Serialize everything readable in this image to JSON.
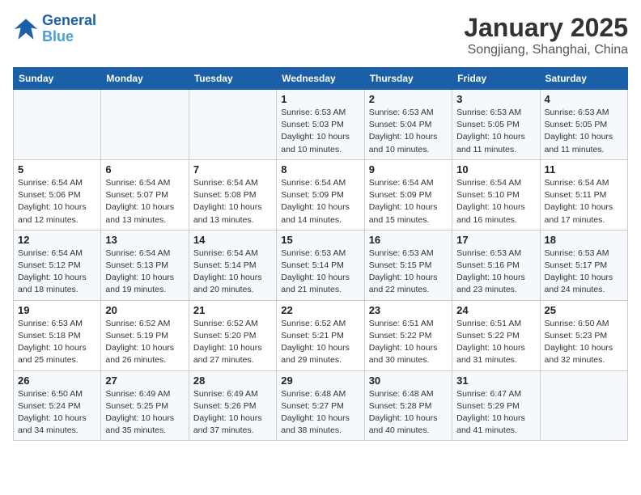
{
  "logo": {
    "line1": "General",
    "line2": "Blue"
  },
  "title": "January 2025",
  "location": "Songjiang, Shanghai, China",
  "weekdays": [
    "Sunday",
    "Monday",
    "Tuesday",
    "Wednesday",
    "Thursday",
    "Friday",
    "Saturday"
  ],
  "weeks": [
    [
      {
        "day": "",
        "info": ""
      },
      {
        "day": "",
        "info": ""
      },
      {
        "day": "",
        "info": ""
      },
      {
        "day": "1",
        "info": "Sunrise: 6:53 AM\nSunset: 5:03 PM\nDaylight: 10 hours\nand 10 minutes."
      },
      {
        "day": "2",
        "info": "Sunrise: 6:53 AM\nSunset: 5:04 PM\nDaylight: 10 hours\nand 10 minutes."
      },
      {
        "day": "3",
        "info": "Sunrise: 6:53 AM\nSunset: 5:05 PM\nDaylight: 10 hours\nand 11 minutes."
      },
      {
        "day": "4",
        "info": "Sunrise: 6:53 AM\nSunset: 5:05 PM\nDaylight: 10 hours\nand 11 minutes."
      }
    ],
    [
      {
        "day": "5",
        "info": "Sunrise: 6:54 AM\nSunset: 5:06 PM\nDaylight: 10 hours\nand 12 minutes."
      },
      {
        "day": "6",
        "info": "Sunrise: 6:54 AM\nSunset: 5:07 PM\nDaylight: 10 hours\nand 13 minutes."
      },
      {
        "day": "7",
        "info": "Sunrise: 6:54 AM\nSunset: 5:08 PM\nDaylight: 10 hours\nand 13 minutes."
      },
      {
        "day": "8",
        "info": "Sunrise: 6:54 AM\nSunset: 5:09 PM\nDaylight: 10 hours\nand 14 minutes."
      },
      {
        "day": "9",
        "info": "Sunrise: 6:54 AM\nSunset: 5:09 PM\nDaylight: 10 hours\nand 15 minutes."
      },
      {
        "day": "10",
        "info": "Sunrise: 6:54 AM\nSunset: 5:10 PM\nDaylight: 10 hours\nand 16 minutes."
      },
      {
        "day": "11",
        "info": "Sunrise: 6:54 AM\nSunset: 5:11 PM\nDaylight: 10 hours\nand 17 minutes."
      }
    ],
    [
      {
        "day": "12",
        "info": "Sunrise: 6:54 AM\nSunset: 5:12 PM\nDaylight: 10 hours\nand 18 minutes."
      },
      {
        "day": "13",
        "info": "Sunrise: 6:54 AM\nSunset: 5:13 PM\nDaylight: 10 hours\nand 19 minutes."
      },
      {
        "day": "14",
        "info": "Sunrise: 6:54 AM\nSunset: 5:14 PM\nDaylight: 10 hours\nand 20 minutes."
      },
      {
        "day": "15",
        "info": "Sunrise: 6:53 AM\nSunset: 5:14 PM\nDaylight: 10 hours\nand 21 minutes."
      },
      {
        "day": "16",
        "info": "Sunrise: 6:53 AM\nSunset: 5:15 PM\nDaylight: 10 hours\nand 22 minutes."
      },
      {
        "day": "17",
        "info": "Sunrise: 6:53 AM\nSunset: 5:16 PM\nDaylight: 10 hours\nand 23 minutes."
      },
      {
        "day": "18",
        "info": "Sunrise: 6:53 AM\nSunset: 5:17 PM\nDaylight: 10 hours\nand 24 minutes."
      }
    ],
    [
      {
        "day": "19",
        "info": "Sunrise: 6:53 AM\nSunset: 5:18 PM\nDaylight: 10 hours\nand 25 minutes."
      },
      {
        "day": "20",
        "info": "Sunrise: 6:52 AM\nSunset: 5:19 PM\nDaylight: 10 hours\nand 26 minutes."
      },
      {
        "day": "21",
        "info": "Sunrise: 6:52 AM\nSunset: 5:20 PM\nDaylight: 10 hours\nand 27 minutes."
      },
      {
        "day": "22",
        "info": "Sunrise: 6:52 AM\nSunset: 5:21 PM\nDaylight: 10 hours\nand 29 minutes."
      },
      {
        "day": "23",
        "info": "Sunrise: 6:51 AM\nSunset: 5:22 PM\nDaylight: 10 hours\nand 30 minutes."
      },
      {
        "day": "24",
        "info": "Sunrise: 6:51 AM\nSunset: 5:22 PM\nDaylight: 10 hours\nand 31 minutes."
      },
      {
        "day": "25",
        "info": "Sunrise: 6:50 AM\nSunset: 5:23 PM\nDaylight: 10 hours\nand 32 minutes."
      }
    ],
    [
      {
        "day": "26",
        "info": "Sunrise: 6:50 AM\nSunset: 5:24 PM\nDaylight: 10 hours\nand 34 minutes."
      },
      {
        "day": "27",
        "info": "Sunrise: 6:49 AM\nSunset: 5:25 PM\nDaylight: 10 hours\nand 35 minutes."
      },
      {
        "day": "28",
        "info": "Sunrise: 6:49 AM\nSunset: 5:26 PM\nDaylight: 10 hours\nand 37 minutes."
      },
      {
        "day": "29",
        "info": "Sunrise: 6:48 AM\nSunset: 5:27 PM\nDaylight: 10 hours\nand 38 minutes."
      },
      {
        "day": "30",
        "info": "Sunrise: 6:48 AM\nSunset: 5:28 PM\nDaylight: 10 hours\nand 40 minutes."
      },
      {
        "day": "31",
        "info": "Sunrise: 6:47 AM\nSunset: 5:29 PM\nDaylight: 10 hours\nand 41 minutes."
      },
      {
        "day": "",
        "info": ""
      }
    ]
  ]
}
